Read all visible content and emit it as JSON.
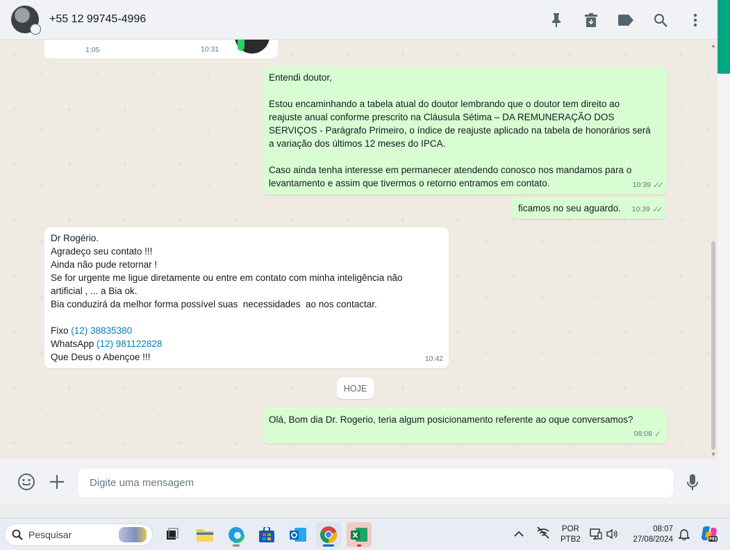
{
  "header": {
    "contact_name": "+55 12 99745-4996",
    "icons": [
      "pin-icon",
      "archive-icon",
      "label-icon",
      "search-icon",
      "menu-dots-icon"
    ]
  },
  "audio_message": {
    "duration": "1:05",
    "time": "10:31"
  },
  "messages": {
    "m1": {
      "lines": [
        "Entendi doutor,",
        "",
        "Estou encaminhando a tabela atual do doutor lembrando que o doutor tem direito ao",
        "reajuste anual conforme prescrito na Cláusula Sétima – DA REMUNERAÇÃO DOS",
        "SERVIÇOS - Parágrafo Primeiro, o índice de reajuste aplicado na tabela de honorários será",
        "a variação dos últimos 12 meses do IPCA.",
        "",
        "Caso ainda tenha interesse em permanecer atendendo conosco nos mandamos para o",
        "levantamento e assim que tivermos o retorno entramos em contato."
      ],
      "time": "10:39"
    },
    "m2": {
      "text": "ficamos no seu aguardo.",
      "time": "10:39"
    },
    "m3": {
      "lines": [
        "Dr Rogério.",
        "Agradeço seu contato !!!",
        "Ainda não pude retornar !",
        "Se for urgente me ligue diretamente ou entre em contato com minha inteligência não",
        "artificial , ... a Bia ok.",
        "Bia conduzirá da melhor forma possível suas  necessidades  ao nos contactar.",
        ""
      ],
      "fixo_label": "Fixo ",
      "fixo_number": "(12) 38835380",
      "whatsapp_label": "WhatsApp ",
      "whatsapp_number": "(12) 981122828",
      "closing": "Que Deus o Abençoe !!!",
      "time": "10:42"
    },
    "day_separator": "HOJE",
    "m4": {
      "text": "Olá, Bom dia Dr. Rogerio, teria algum posicionamento referente ao oque conversamos?",
      "time": "08:08"
    }
  },
  "composer": {
    "placeholder": "Digite uma mensagem"
  },
  "taskbar": {
    "search_label": "Pesquisar",
    "language": "POR",
    "keyboard": "PTB2",
    "time": "08:07",
    "date": "27/08/2024"
  },
  "colors": {
    "accent": "#00a884",
    "outgoing": "#d9fdd3",
    "incoming": "#ffffff",
    "link": "#027eb5"
  }
}
